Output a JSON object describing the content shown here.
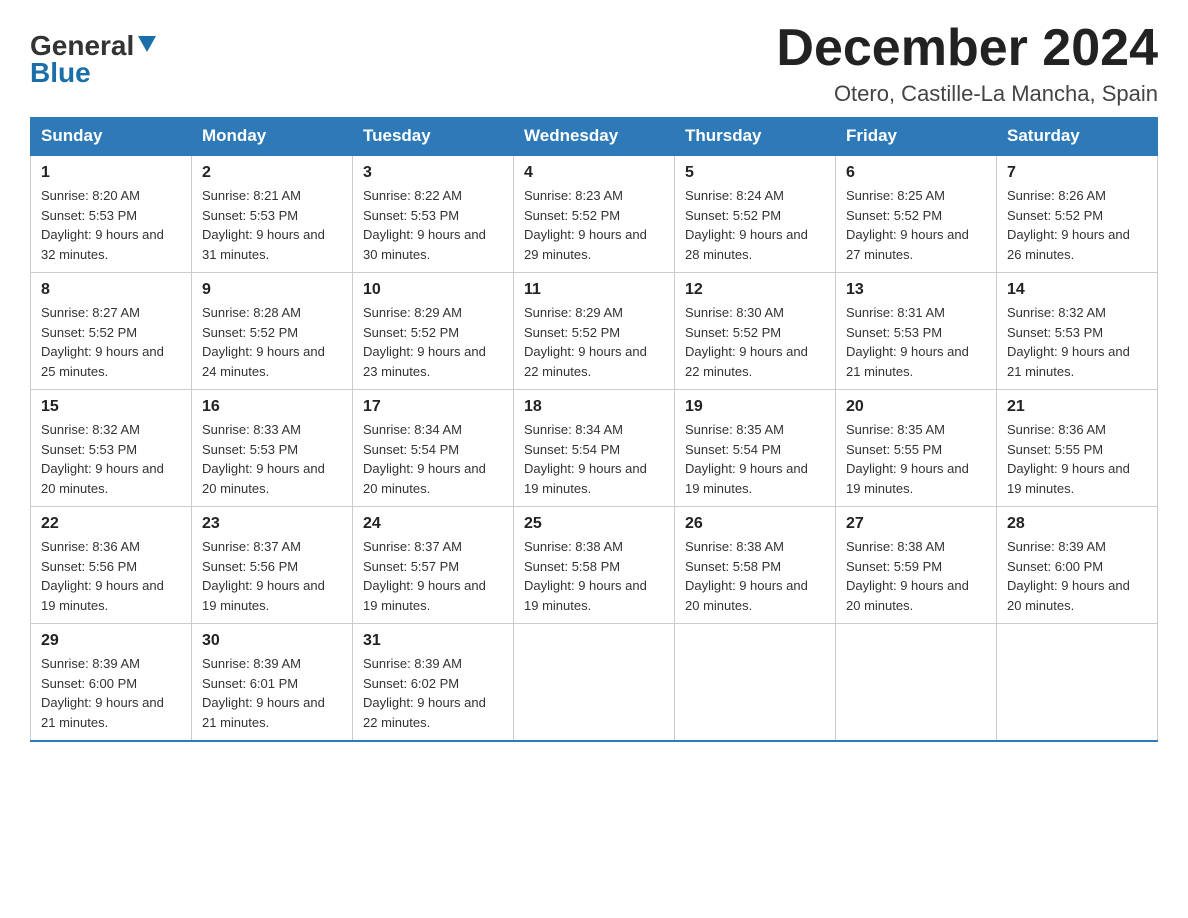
{
  "header": {
    "logo_general": "General",
    "logo_blue": "Blue",
    "month_title": "December 2024",
    "subtitle": "Otero, Castille-La Mancha, Spain"
  },
  "days_of_week": [
    "Sunday",
    "Monday",
    "Tuesday",
    "Wednesday",
    "Thursday",
    "Friday",
    "Saturday"
  ],
  "weeks": [
    [
      {
        "day": "1",
        "sunrise": "Sunrise: 8:20 AM",
        "sunset": "Sunset: 5:53 PM",
        "daylight": "Daylight: 9 hours and 32 minutes."
      },
      {
        "day": "2",
        "sunrise": "Sunrise: 8:21 AM",
        "sunset": "Sunset: 5:53 PM",
        "daylight": "Daylight: 9 hours and 31 minutes."
      },
      {
        "day": "3",
        "sunrise": "Sunrise: 8:22 AM",
        "sunset": "Sunset: 5:53 PM",
        "daylight": "Daylight: 9 hours and 30 minutes."
      },
      {
        "day": "4",
        "sunrise": "Sunrise: 8:23 AM",
        "sunset": "Sunset: 5:52 PM",
        "daylight": "Daylight: 9 hours and 29 minutes."
      },
      {
        "day": "5",
        "sunrise": "Sunrise: 8:24 AM",
        "sunset": "Sunset: 5:52 PM",
        "daylight": "Daylight: 9 hours and 28 minutes."
      },
      {
        "day": "6",
        "sunrise": "Sunrise: 8:25 AM",
        "sunset": "Sunset: 5:52 PM",
        "daylight": "Daylight: 9 hours and 27 minutes."
      },
      {
        "day": "7",
        "sunrise": "Sunrise: 8:26 AM",
        "sunset": "Sunset: 5:52 PM",
        "daylight": "Daylight: 9 hours and 26 minutes."
      }
    ],
    [
      {
        "day": "8",
        "sunrise": "Sunrise: 8:27 AM",
        "sunset": "Sunset: 5:52 PM",
        "daylight": "Daylight: 9 hours and 25 minutes."
      },
      {
        "day": "9",
        "sunrise": "Sunrise: 8:28 AM",
        "sunset": "Sunset: 5:52 PM",
        "daylight": "Daylight: 9 hours and 24 minutes."
      },
      {
        "day": "10",
        "sunrise": "Sunrise: 8:29 AM",
        "sunset": "Sunset: 5:52 PM",
        "daylight": "Daylight: 9 hours and 23 minutes."
      },
      {
        "day": "11",
        "sunrise": "Sunrise: 8:29 AM",
        "sunset": "Sunset: 5:52 PM",
        "daylight": "Daylight: 9 hours and 22 minutes."
      },
      {
        "day": "12",
        "sunrise": "Sunrise: 8:30 AM",
        "sunset": "Sunset: 5:52 PM",
        "daylight": "Daylight: 9 hours and 22 minutes."
      },
      {
        "day": "13",
        "sunrise": "Sunrise: 8:31 AM",
        "sunset": "Sunset: 5:53 PM",
        "daylight": "Daylight: 9 hours and 21 minutes."
      },
      {
        "day": "14",
        "sunrise": "Sunrise: 8:32 AM",
        "sunset": "Sunset: 5:53 PM",
        "daylight": "Daylight: 9 hours and 21 minutes."
      }
    ],
    [
      {
        "day": "15",
        "sunrise": "Sunrise: 8:32 AM",
        "sunset": "Sunset: 5:53 PM",
        "daylight": "Daylight: 9 hours and 20 minutes."
      },
      {
        "day": "16",
        "sunrise": "Sunrise: 8:33 AM",
        "sunset": "Sunset: 5:53 PM",
        "daylight": "Daylight: 9 hours and 20 minutes."
      },
      {
        "day": "17",
        "sunrise": "Sunrise: 8:34 AM",
        "sunset": "Sunset: 5:54 PM",
        "daylight": "Daylight: 9 hours and 20 minutes."
      },
      {
        "day": "18",
        "sunrise": "Sunrise: 8:34 AM",
        "sunset": "Sunset: 5:54 PM",
        "daylight": "Daylight: 9 hours and 19 minutes."
      },
      {
        "day": "19",
        "sunrise": "Sunrise: 8:35 AM",
        "sunset": "Sunset: 5:54 PM",
        "daylight": "Daylight: 9 hours and 19 minutes."
      },
      {
        "day": "20",
        "sunrise": "Sunrise: 8:35 AM",
        "sunset": "Sunset: 5:55 PM",
        "daylight": "Daylight: 9 hours and 19 minutes."
      },
      {
        "day": "21",
        "sunrise": "Sunrise: 8:36 AM",
        "sunset": "Sunset: 5:55 PM",
        "daylight": "Daylight: 9 hours and 19 minutes."
      }
    ],
    [
      {
        "day": "22",
        "sunrise": "Sunrise: 8:36 AM",
        "sunset": "Sunset: 5:56 PM",
        "daylight": "Daylight: 9 hours and 19 minutes."
      },
      {
        "day": "23",
        "sunrise": "Sunrise: 8:37 AM",
        "sunset": "Sunset: 5:56 PM",
        "daylight": "Daylight: 9 hours and 19 minutes."
      },
      {
        "day": "24",
        "sunrise": "Sunrise: 8:37 AM",
        "sunset": "Sunset: 5:57 PM",
        "daylight": "Daylight: 9 hours and 19 minutes."
      },
      {
        "day": "25",
        "sunrise": "Sunrise: 8:38 AM",
        "sunset": "Sunset: 5:58 PM",
        "daylight": "Daylight: 9 hours and 19 minutes."
      },
      {
        "day": "26",
        "sunrise": "Sunrise: 8:38 AM",
        "sunset": "Sunset: 5:58 PM",
        "daylight": "Daylight: 9 hours and 20 minutes."
      },
      {
        "day": "27",
        "sunrise": "Sunrise: 8:38 AM",
        "sunset": "Sunset: 5:59 PM",
        "daylight": "Daylight: 9 hours and 20 minutes."
      },
      {
        "day": "28",
        "sunrise": "Sunrise: 8:39 AM",
        "sunset": "Sunset: 6:00 PM",
        "daylight": "Daylight: 9 hours and 20 minutes."
      }
    ],
    [
      {
        "day": "29",
        "sunrise": "Sunrise: 8:39 AM",
        "sunset": "Sunset: 6:00 PM",
        "daylight": "Daylight: 9 hours and 21 minutes."
      },
      {
        "day": "30",
        "sunrise": "Sunrise: 8:39 AM",
        "sunset": "Sunset: 6:01 PM",
        "daylight": "Daylight: 9 hours and 21 minutes."
      },
      {
        "day": "31",
        "sunrise": "Sunrise: 8:39 AM",
        "sunset": "Sunset: 6:02 PM",
        "daylight": "Daylight: 9 hours and 22 minutes."
      },
      null,
      null,
      null,
      null
    ]
  ]
}
